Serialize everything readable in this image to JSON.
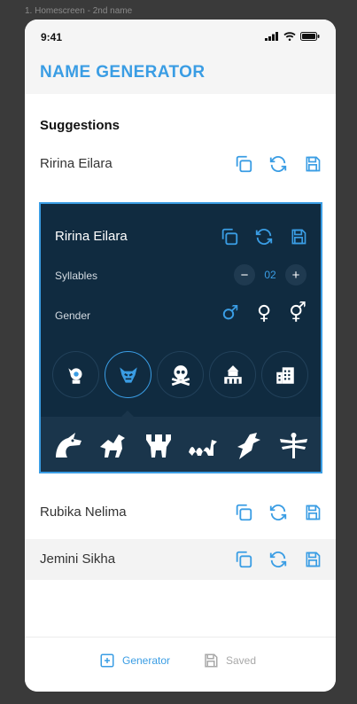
{
  "frame_label": "1. Homescreen - 2nd name",
  "status": {
    "time": "9:41"
  },
  "app": {
    "title": "NAME GENERATOR"
  },
  "section": {
    "title": "Suggestions"
  },
  "suggestions": [
    {
      "name": "Ririna Eilara"
    },
    {
      "name": "Rubika Nelima"
    },
    {
      "name": "Jemini Sikha"
    }
  ],
  "card": {
    "name": "Ririna Eilara",
    "syllables_label": "Syllables",
    "syllables_value": "02",
    "minus": "−",
    "plus": "+",
    "gender_label": "Gender",
    "genders": [
      {
        "icon": "male-icon",
        "glyph": "♂",
        "color": "#3a9de4"
      },
      {
        "icon": "female-icon",
        "glyph": "♀",
        "color": "#ffffff"
      },
      {
        "icon": "mars-venus-icon",
        "glyph": "⚥",
        "color": "#ffffff"
      }
    ],
    "categories": [
      {
        "icon": "elf-icon",
        "active": false
      },
      {
        "icon": "monster-mask-icon",
        "active": true
      },
      {
        "icon": "skull-crossbones-icon",
        "active": false
      },
      {
        "icon": "temple-icon",
        "active": false
      },
      {
        "icon": "city-building-icon",
        "active": false
      }
    ],
    "creatures": [
      "dragon-head-icon",
      "dragon-icon",
      "hydra-icon",
      "sea-serpent-icon",
      "wyvern-icon",
      "dragonfly-icon"
    ]
  },
  "nav": {
    "generator": "Generator",
    "saved": "Saved",
    "active_color": "#3a9de4",
    "inactive_color": "#a8a8a8"
  },
  "colors": {
    "accent": "#3a9de4",
    "card_bg": "#102b40",
    "tray_bg": "#1a354b"
  }
}
